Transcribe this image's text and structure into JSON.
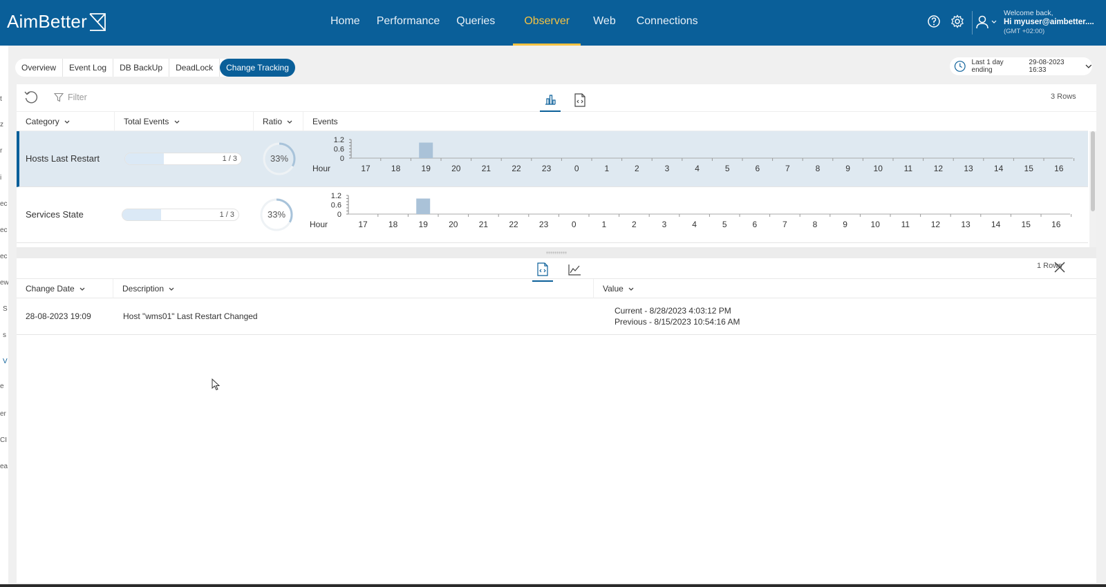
{
  "app": {
    "logo": "AimBetter",
    "nav": [
      "Home",
      "Performance",
      "Queries",
      "Observer",
      "Web",
      "Connections"
    ],
    "active_nav": "Observer",
    "user": {
      "welcome": "Welcome back,",
      "name": "Hi myuser@aimbetter....",
      "timezone": "(GMT +02:00)"
    }
  },
  "left_strip": [
    "t",
    "z",
    "r",
    "i",
    "ec",
    "ec",
    "ec",
    "ew",
    "S",
    "s",
    "V",
    "e",
    "er",
    "CI",
    "ea"
  ],
  "tabs": [
    "Overview",
    "Event Log",
    "DB BackUp",
    "DeadLock",
    "Change Tracking"
  ],
  "active_tab": "Change Tracking",
  "time_range": {
    "label": "Last 1 day ending",
    "date": "29-08-2023 16:33"
  },
  "upper_panel": {
    "filter_placeholder": "Filter",
    "rows_count": "3 Rows",
    "columns": {
      "category": "Category",
      "total_events": "Total Events",
      "ratio": "Ratio",
      "events": "Events"
    },
    "rows": [
      {
        "category": "Hosts Last Restart",
        "progress_text": "1 / 3",
        "progress": 0.333,
        "ratio": "33%",
        "ratio_value": 0.33,
        "selected": true
      },
      {
        "category": "Services State",
        "progress_text": "1 / 3",
        "progress": 0.333,
        "ratio": "33%",
        "ratio_value": 0.33,
        "selected": false
      }
    ]
  },
  "chart_data": {
    "type": "bar",
    "xlabel": "Hour",
    "categories": [
      "17",
      "18",
      "19",
      "20",
      "21",
      "22",
      "23",
      "0",
      "1",
      "2",
      "3",
      "4",
      "5",
      "6",
      "7",
      "8",
      "9",
      "10",
      "11",
      "12",
      "13",
      "14",
      "15",
      "16"
    ],
    "yticks": [
      "1.2",
      "0.6",
      "0"
    ],
    "ylim": [
      0,
      1.2
    ],
    "series": [
      {
        "values": [
          0,
          0,
          1,
          0,
          0,
          0,
          0,
          0,
          0,
          0,
          0,
          0,
          0,
          0,
          0,
          0,
          0,
          0,
          0,
          0,
          0,
          0,
          0,
          0
        ]
      },
      {
        "values": [
          0,
          0,
          1,
          0,
          0,
          0,
          0,
          0,
          0,
          0,
          0,
          0,
          0,
          0,
          0,
          0,
          0,
          0,
          0,
          0,
          0,
          0,
          0,
          0
        ]
      }
    ],
    "bar_color": "#aac2d8"
  },
  "lower_panel": {
    "rows_count": "1 Rows",
    "columns": {
      "change_date": "Change Date",
      "description": "Description",
      "value": "Value"
    },
    "rows": [
      {
        "change_date": "28-08-2023 19:09",
        "description": "Host \"wms01\" Last Restart Changed",
        "value_current": "Current - 8/28/2023 4:03:12 PM",
        "value_previous": "Previous - 8/15/2023 10:54:16 AM"
      }
    ]
  },
  "colors": {
    "brand": "#0a5f99",
    "accent": "#f5c242",
    "selected_row": "#dfe9f1"
  }
}
